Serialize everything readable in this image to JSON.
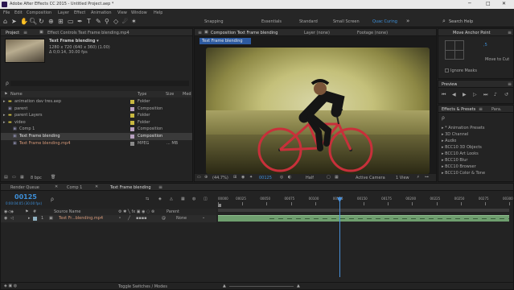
{
  "window": {
    "title": "Adobe After Effects CC 2015 - Untitled Project.aep *",
    "min": "─",
    "max": "□",
    "close": "✕"
  },
  "menu": [
    "File",
    "Edit",
    "Composition",
    "Layer",
    "Effect",
    "Animation",
    "View",
    "Window",
    "Help"
  ],
  "workspaces": [
    "Snapping",
    "Essentials",
    "Standard",
    "Small Screen",
    "Quac Curing"
  ],
  "active_workspace": 4,
  "search_help": "Search Help",
  "project": {
    "tab": "Project",
    "effect_controls_tab": "Effect Controls Text Frame blending.mp4",
    "preview_name": "Text Frame blending ▾",
    "preview_info": [
      "1280 x 720 (640 x 360) (1.00)",
      "Δ 0;0:14, 30.00 fps"
    ],
    "search_placeholder": "ρ",
    "columns": [
      "Name",
      "Type",
      "Size",
      "Med"
    ],
    "items": [
      {
        "name": "animation dav tres.aep",
        "type": "Folder",
        "size": "",
        "color": "#c8b840",
        "indent": 0
      },
      {
        "name": "parent",
        "type": "Composition",
        "size": "",
        "color": "#b8a0c0",
        "indent": 0
      },
      {
        "name": "parent Layers",
        "type": "Folder",
        "size": "",
        "color": "#c8b840",
        "indent": 0
      },
      {
        "name": "video",
        "type": "Folder",
        "size": "",
        "color": "#c8b840",
        "indent": 0
      },
      {
        "name": "Comp 1",
        "type": "Composition",
        "size": "",
        "color": "#b8a0c0",
        "indent": 1
      },
      {
        "name": "Text Frame blending",
        "type": "Composition",
        "size": "",
        "color": "#b8a0c0",
        "indent": 1
      },
      {
        "name": "Text Frame blending.mp4",
        "type": "MPEG",
        "size": "... MB",
        "color": "#8a8a8a",
        "indent": 1
      }
    ],
    "bpc": "8 bpc"
  },
  "composition": {
    "tab": "Composition Text Frame blending",
    "layer_tab": "Layer (none)",
    "footage_tab": "Footage (none)",
    "sub_tab": "Text Frame blending",
    "zoom": "(44.7%)",
    "timecode": "00125",
    "resolution": "Half",
    "camera": "Active Camera",
    "views": "1 View",
    "offset": "+0.0"
  },
  "right_panel": {
    "move_anchor_tab": "Move Anchor Point",
    "x_value": ",5",
    "move_to_cut": "Move to Cut",
    "ignore_masks": "Ignore Masks",
    "preview_tab": "Preview",
    "effects_tab": "Effects & Presets",
    "paragraph_tab": "Para.",
    "search_placeholder": "ρ",
    "effects": [
      "* Animation Presets",
      "3D Channel",
      "Audio",
      "BCC10 3D Objects",
      "BCC10 Art Looks",
      "BCC10 Blur",
      "BCC10 Browser",
      "BCC10 Color & Tone"
    ]
  },
  "timeline": {
    "tabs": [
      "Render Queue",
      "Comp 1",
      "Text Frame blending"
    ],
    "active_tab": 2,
    "timecode": "00125",
    "timecode_sub": "0:00:04:05 (30.00 fps)",
    "search_placeholder": "ρ",
    "columns": {
      "source": "Source Name",
      "parent": "Parent"
    },
    "ruler": [
      "00000",
      "00025",
      "00050",
      "00075",
      "00100",
      "00125",
      "00150",
      "00175",
      "00200",
      "00225",
      "00250",
      "00275",
      "00300"
    ],
    "playhead_frame": 125,
    "max_frame": 300,
    "layer": {
      "num": "1",
      "name": "Text Fr...blending.mp4",
      "parent": "None"
    },
    "footer": "Toggle Switches / Modes"
  },
  "colors": {
    "accent": "#3d8fd8",
    "playhead": "#4a90d9",
    "layer_bar": "#6f9f6f"
  }
}
